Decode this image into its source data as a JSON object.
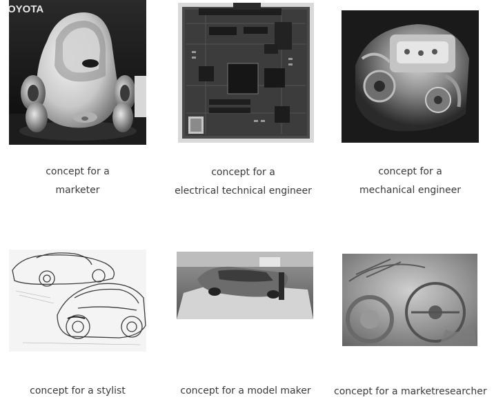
{
  "items": [
    {
      "image": "concept-car-photo",
      "brand_text": "OYOTA",
      "caption_lines": [
        "concept for a",
        "marketer"
      ]
    },
    {
      "image": "circuit-board-photo",
      "caption_lines": [
        "concept for a",
        "electrical technical engineer"
      ]
    },
    {
      "image": "engine-photo",
      "caption_lines": [
        "concept for a",
        "mechanical engineer"
      ]
    },
    {
      "image": "car-sketch",
      "caption_lines": [
        "concept for a stylist"
      ]
    },
    {
      "image": "car-model-photo",
      "caption_lines": [
        "concept for a model maker"
      ]
    },
    {
      "image": "market-research-photo",
      "caption_lines": [
        "concept for a marketresearcher"
      ]
    }
  ]
}
